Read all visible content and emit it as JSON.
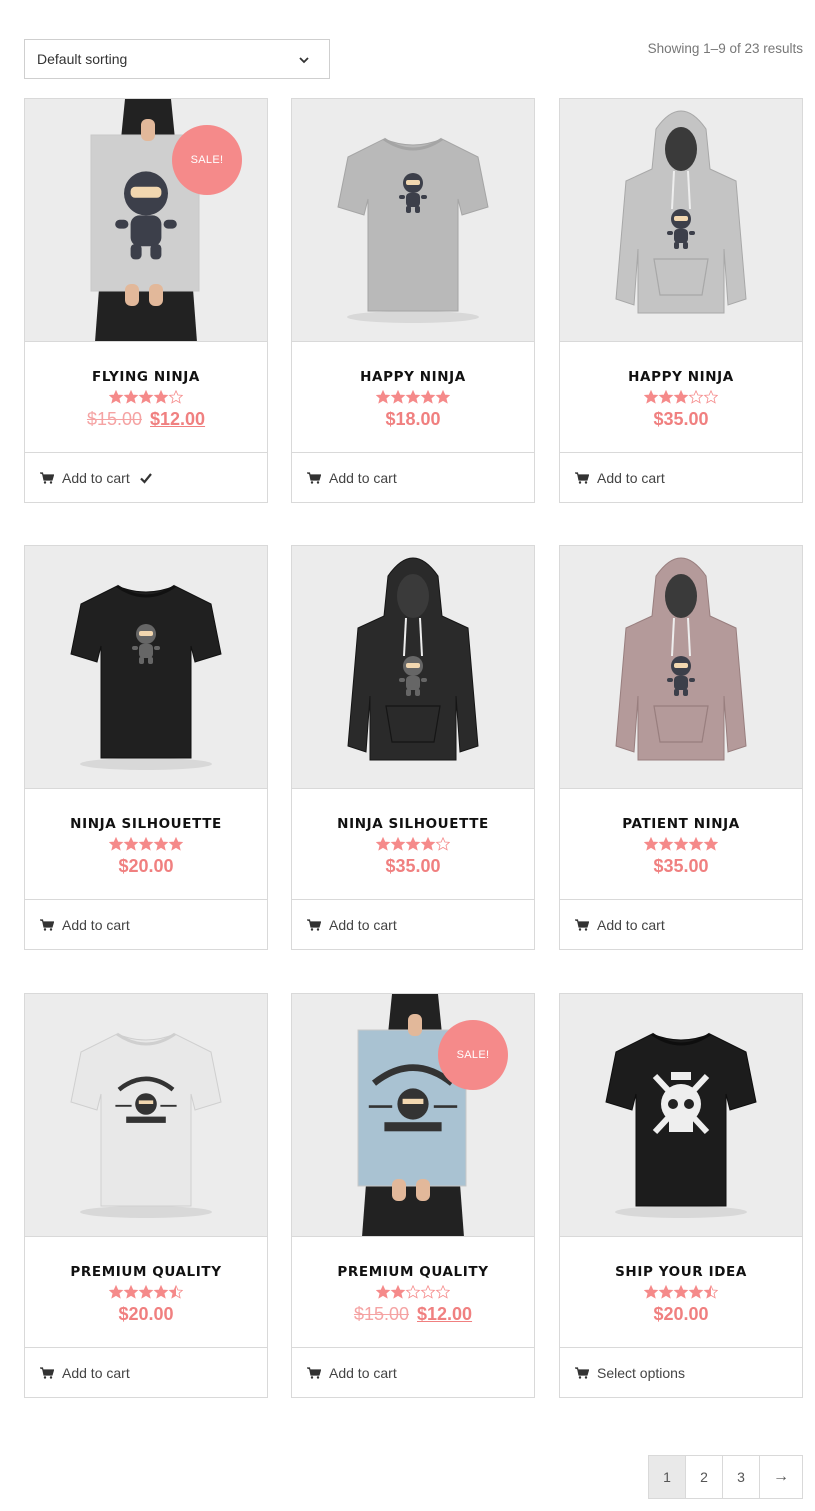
{
  "toolbar": {
    "sort_value": "Default sorting",
    "result_count": "Showing 1–9 of 23 results"
  },
  "colors": {
    "accent": "#f58a8a",
    "price": "#f08080"
  },
  "products": [
    {
      "title": "FLYING NINJA",
      "rating": 4.0,
      "old_price": "$15.00",
      "price": "$12.00",
      "sale": "SALE!",
      "button": "Add to cart",
      "added": true,
      "image": "poster-ninja"
    },
    {
      "title": "HAPPY NINJA",
      "rating": 5.0,
      "price": "$18.00",
      "button": "Add to cart",
      "image": "tshirt-grey"
    },
    {
      "title": "HAPPY NINJA",
      "rating": 3.0,
      "price": "$35.00",
      "button": "Add to cart",
      "image": "hoodie-grey"
    },
    {
      "title": "NINJA SILHOUETTE",
      "rating": 5.0,
      "price": "$20.00",
      "button": "Add to cart",
      "image": "tshirt-black"
    },
    {
      "title": "NINJA SILHOUETTE",
      "rating": 4.0,
      "price": "$35.00",
      "button": "Add to cart",
      "image": "hoodie-black"
    },
    {
      "title": "PATIENT NINJA",
      "rating": 5.0,
      "price": "$35.00",
      "button": "Add to cart",
      "image": "hoodie-mauve"
    },
    {
      "title": "PREMIUM QUALITY",
      "rating": 4.5,
      "price": "$20.00",
      "button": "Add to cart",
      "image": "tshirt-white"
    },
    {
      "title": "PREMIUM QUALITY",
      "rating": 2.0,
      "old_price": "$15.00",
      "price": "$12.00",
      "sale": "SALE!",
      "button": "Add to cart",
      "image": "poster-woo"
    },
    {
      "title": "SHIP YOUR IDEA",
      "rating": 4.5,
      "price": "$20.00",
      "button": "Select options",
      "image": "tshirt-skull"
    }
  ],
  "pagination": {
    "pages": [
      "1",
      "2",
      "3"
    ],
    "current": "1",
    "next": "→"
  }
}
